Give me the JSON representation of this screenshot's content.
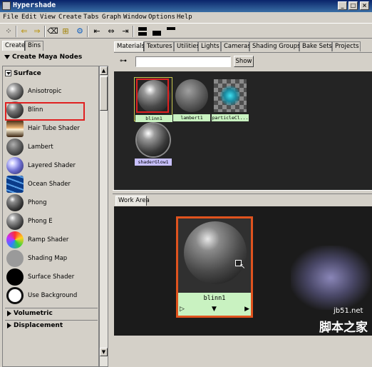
{
  "window": {
    "title": "Hypershade",
    "min": "_",
    "max": "□",
    "close": "×"
  },
  "menu": [
    "File",
    "Edit",
    "View",
    "Create",
    "Tabs",
    "Graph",
    "Window",
    "Options",
    "Help"
  ],
  "left_panel": {
    "tabs": [
      "Create",
      "Bins"
    ],
    "header": "Create Maya Nodes",
    "section": "Surface",
    "items": [
      {
        "label": "Anisotropic",
        "icon": "anisotropic-swatch-icon"
      },
      {
        "label": "Blinn",
        "icon": "blinn-swatch-icon"
      },
      {
        "label": "Hair Tube Shader",
        "icon": "hair-tube-swatch-icon"
      },
      {
        "label": "Lambert",
        "icon": "lambert-swatch-icon"
      },
      {
        "label": "Layered Shader",
        "icon": "layered-shader-swatch-icon"
      },
      {
        "label": "Ocean Shader",
        "icon": "ocean-shader-swatch-icon"
      },
      {
        "label": "Phong",
        "icon": "phong-swatch-icon"
      },
      {
        "label": "Phong E",
        "icon": "phong-e-swatch-icon"
      },
      {
        "label": "Ramp Shader",
        "icon": "ramp-shader-swatch-icon"
      },
      {
        "label": "Shading Map",
        "icon": "shading-map-swatch-icon"
      },
      {
        "label": "Surface Shader",
        "icon": "surface-shader-swatch-icon"
      },
      {
        "label": "Use Background",
        "icon": "use-background-swatch-icon"
      }
    ],
    "collapsed_sections": [
      "Volumetric",
      "Displacement"
    ]
  },
  "top_tabs": [
    "Materials",
    "Textures",
    "Utilities",
    "Lights",
    "Cameras",
    "Shading Groups",
    "Bake Sets",
    "Projects"
  ],
  "tree": {
    "show_label": "Show",
    "field_value": ""
  },
  "materials": [
    {
      "name": "blinn1",
      "type": "blinn"
    },
    {
      "name": "lambert1",
      "type": "lambert"
    },
    {
      "name": "particleCl...",
      "type": "particle-cloud"
    },
    {
      "name": "shaderGlow1",
      "type": "shader-glow"
    }
  ],
  "work_area": {
    "tab": "Work Area",
    "node_label": "blinn1"
  },
  "watermark": {
    "site": "jb51.net",
    "text": "脚本之家"
  },
  "colors": {
    "selection_red": "#e02020",
    "node_border": "#e0531e",
    "label_green": "#c9f2c1",
    "label_purple": "#c8c0ff"
  }
}
